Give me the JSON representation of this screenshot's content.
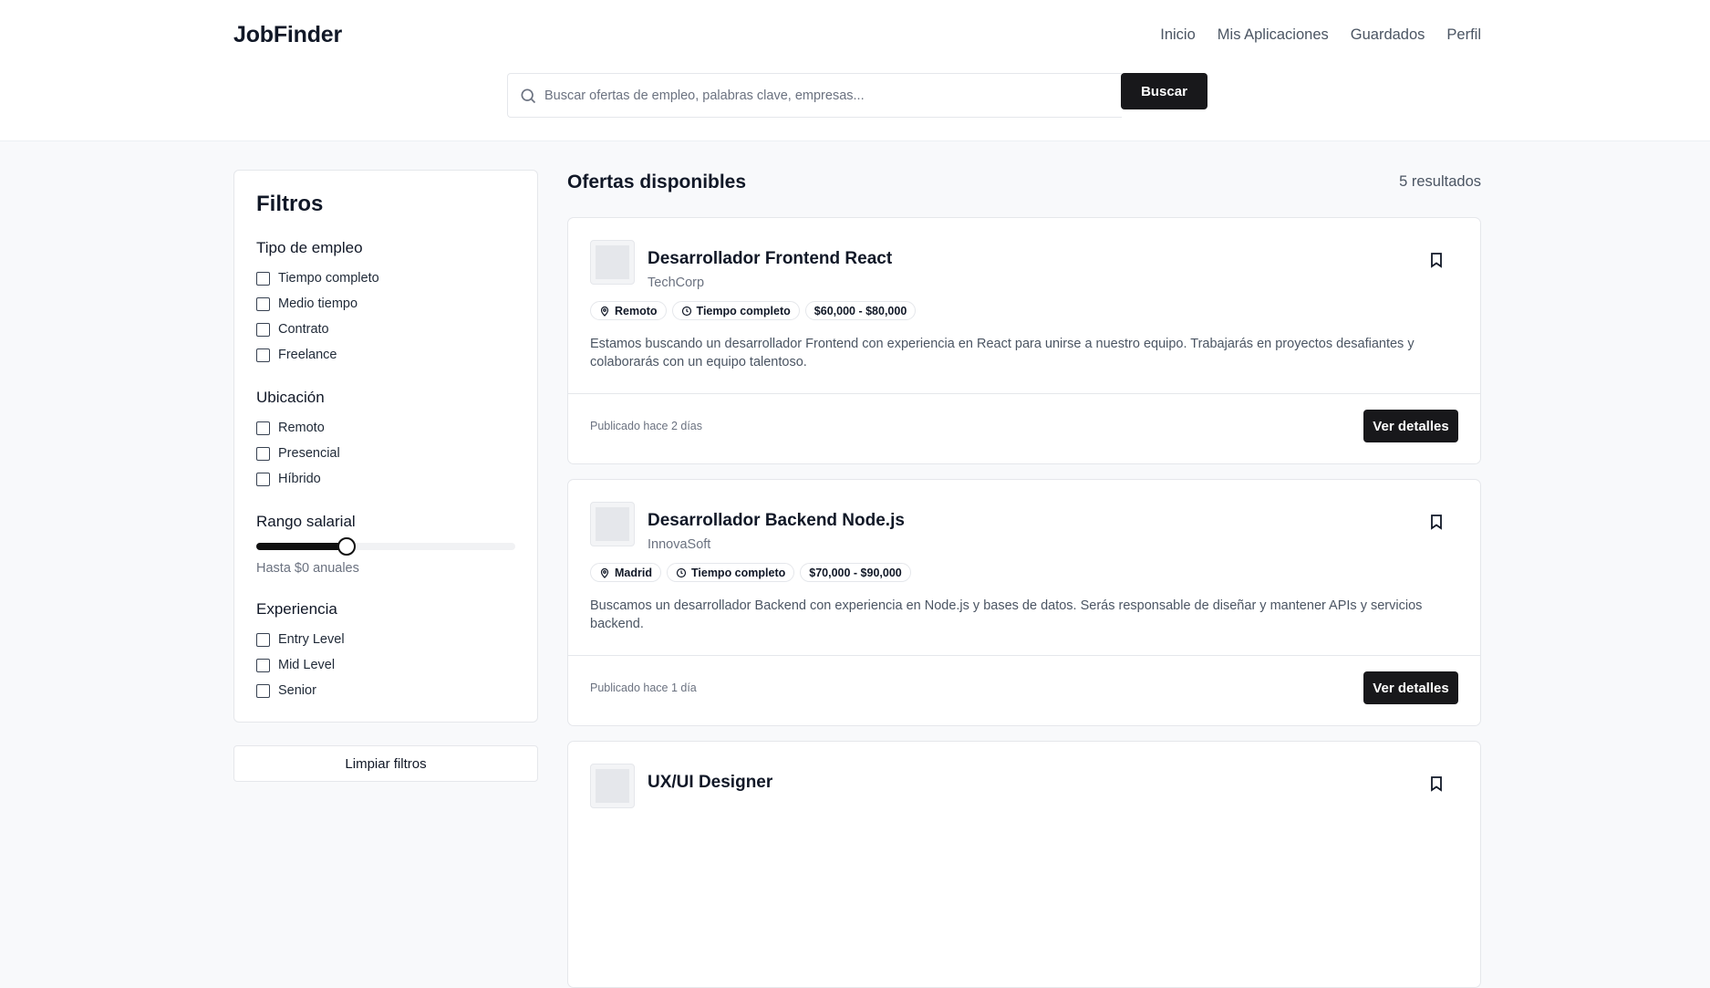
{
  "app": {
    "name": "JobFinder"
  },
  "nav": [
    "Inicio",
    "Mis Aplicaciones",
    "Guardados",
    "Perfil"
  ],
  "search": {
    "placeholder": "Buscar ofertas de empleo, palabras clave, empresas...",
    "button": "Buscar"
  },
  "filters": {
    "title": "Filtros",
    "job_type": {
      "title": "Tipo de empleo",
      "options": [
        "Tiempo completo",
        "Medio tiempo",
        "Contrato",
        "Freelance"
      ]
    },
    "location": {
      "title": "Ubicación",
      "options": [
        "Remoto",
        "Presencial",
        "Híbrido"
      ]
    },
    "salary": {
      "title": "Rango salarial",
      "note": "Hasta $0 anuales",
      "slider_value_percent": 35
    },
    "experience": {
      "title": "Experiencia",
      "options": [
        "Entry Level",
        "Mid Level",
        "Senior"
      ]
    },
    "clear_label": "Limpiar filtros"
  },
  "main": {
    "title": "Ofertas disponibles",
    "results": "5 resultados"
  },
  "jobs": [
    {
      "title": "Desarrollador Frontend React",
      "company": "TechCorp",
      "location": "Remoto",
      "type": "Tiempo completo",
      "salary": "$60,000 - $80,000",
      "description": "Estamos buscando un desarrollador Frontend con experiencia en React para unirse a nuestro equipo. Trabajarás en proyectos desafiantes y colaborarás con un equipo talentoso.",
      "posted": "Publicado hace 2 días",
      "button": "Ver detalles"
    },
    {
      "title": "Desarrollador Backend Node.js",
      "company": "InnovaSoft",
      "location": "Madrid",
      "type": "Tiempo completo",
      "salary": "$70,000 - $90,000",
      "description": "Buscamos un desarrollador Backend con experiencia en Node.js y bases de datos. Serás responsable de diseñar y mantener APIs y servicios backend.",
      "posted": "Publicado hace 1 día",
      "button": "Ver detalles"
    },
    {
      "title": "UX/UI Designer",
      "company": "",
      "location": "",
      "type": "",
      "salary": "",
      "description": "",
      "posted": "",
      "button": ""
    }
  ]
}
